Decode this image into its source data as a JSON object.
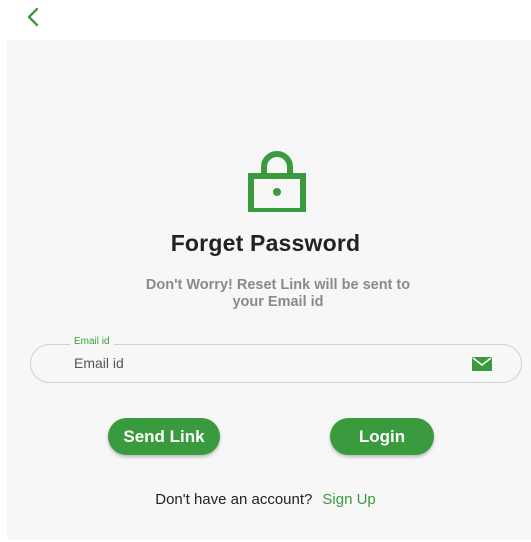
{
  "header": {
    "back_icon": "chevron-left-icon"
  },
  "colors": {
    "accent": "#3a9a3e",
    "title": "#222222",
    "subtitle": "#8a8a8a",
    "panel_bg": "#f7f7f7"
  },
  "hero": {
    "icon": "lock-icon",
    "title": "Forget Password",
    "subtitle": "Don't Worry! Reset Link will be sent to your Email id"
  },
  "form": {
    "email": {
      "label": "Email id",
      "placeholder": "Email id",
      "value": "",
      "icon": "mail-icon"
    }
  },
  "actions": {
    "send_link_label": "Send Link",
    "login_label": "Login"
  },
  "footer": {
    "prompt": "Don't have an account?",
    "signup_label": "Sign Up"
  }
}
